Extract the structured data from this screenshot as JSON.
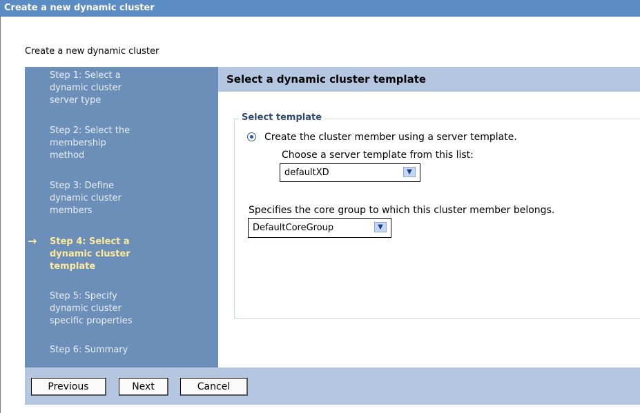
{
  "window": {
    "title": "Create a new dynamic cluster"
  },
  "page": {
    "subtitle": "Create a new dynamic cluster"
  },
  "steps": [
    {
      "lines": [
        "Step 1: Select a",
        "dynamic cluster",
        "server type"
      ]
    },
    {
      "lines": [
        "Step 2: Select the",
        "membership",
        "method"
      ]
    },
    {
      "lines": [
        "Step 3: Define",
        "dynamic cluster",
        "members"
      ]
    },
    {
      "lines": [
        "Step 4: Select a",
        "dynamic cluster",
        "template"
      ]
    },
    {
      "lines": [
        "Step 5: Specify",
        "dynamic cluster",
        "specific properties"
      ]
    },
    {
      "lines": [
        "Step 6: Summary"
      ]
    }
  ],
  "content": {
    "header": "Select a dynamic cluster template",
    "fieldset_legend": "Select template",
    "radio_label": "Create the cluster member using a server template.",
    "choose_label": "Choose a server template from this list:",
    "template_select_value": "defaultXD",
    "core_group_label": "Specifies the core group to which this cluster member belongs.",
    "core_group_select_value": "DefaultCoreGroup"
  },
  "buttons": {
    "previous": "Previous",
    "next": "Next",
    "cancel": "Cancel"
  },
  "icons": {
    "current_step": "right-arrow-icon",
    "dropdown": "chevron-down-icon"
  },
  "colors": {
    "titlebar": "#5b8cc4",
    "steps_panel": "#6c8fba",
    "current_step": "#ffe99a",
    "header_band": "#b4c6e0"
  }
}
